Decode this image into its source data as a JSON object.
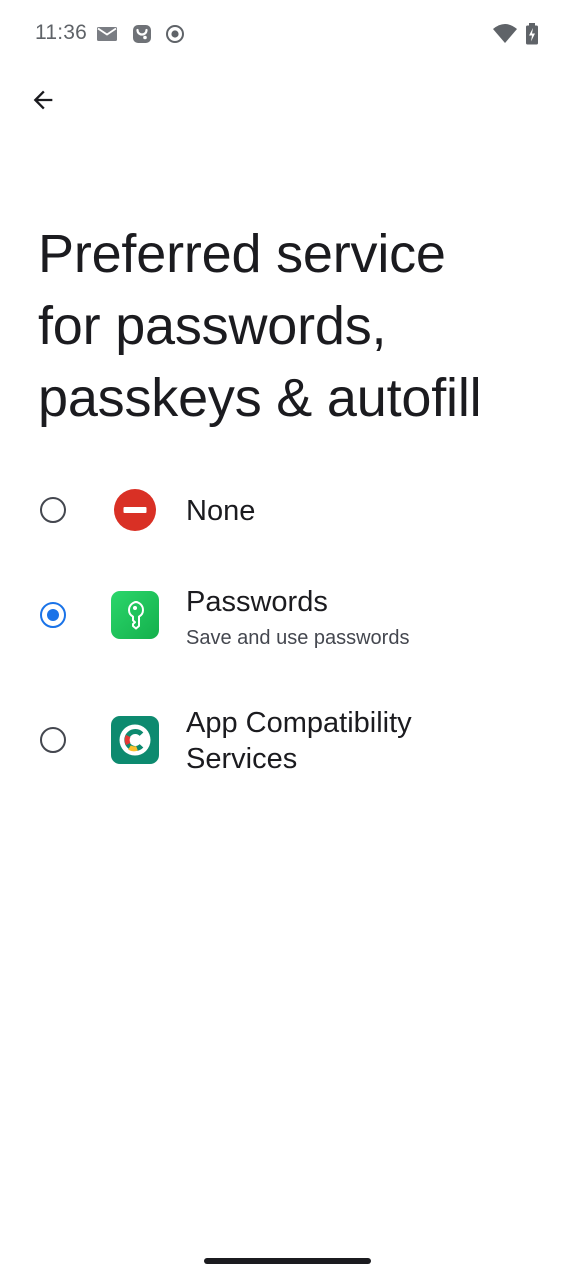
{
  "status_bar": {
    "time": "11:36",
    "icons_left": [
      "gmail-icon",
      "app-notification-icon",
      "record-icon"
    ],
    "icons_right": [
      "wifi-icon",
      "battery-charging-icon"
    ]
  },
  "header": {
    "back_icon": "arrow-back-icon"
  },
  "page": {
    "title_lines": [
      "Preferred service",
      "for passwords,",
      "passkeys & autofill"
    ]
  },
  "options": [
    {
      "title": "None",
      "subtitle": "",
      "icon": "none-icon",
      "icon_color": "#d93025",
      "selected": false
    },
    {
      "title": "Passwords",
      "subtitle": "Save and use passwords",
      "icon": "passwords-app-icon",
      "icon_color": "#21c55d",
      "selected": true
    },
    {
      "title_lines": [
        "App Compatibility",
        "Services"
      ],
      "subtitle": "",
      "icon": "app-compatibility-icon",
      "icon_color": "#0d8a6f",
      "selected": false
    }
  ],
  "colors": {
    "accent": "#1a73e8",
    "text_primary": "#1b1b1f",
    "text_secondary": "#44474f"
  }
}
